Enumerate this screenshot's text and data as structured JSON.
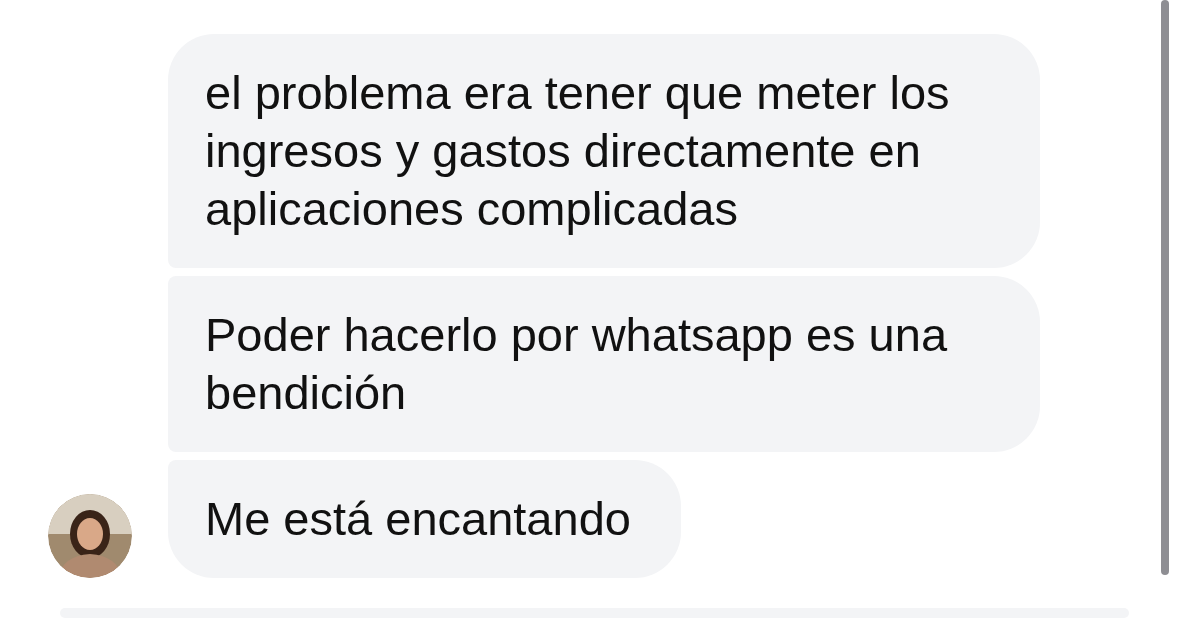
{
  "messages": [
    {
      "text": "el problema era tener que meter los ingresos y gastos directamente en aplicaciones complicadas",
      "avatar": false
    },
    {
      "text": "Poder hacerlo por whatsapp es una bendición",
      "avatar": false
    },
    {
      "text": "Me está encantando",
      "avatar": true
    }
  ]
}
